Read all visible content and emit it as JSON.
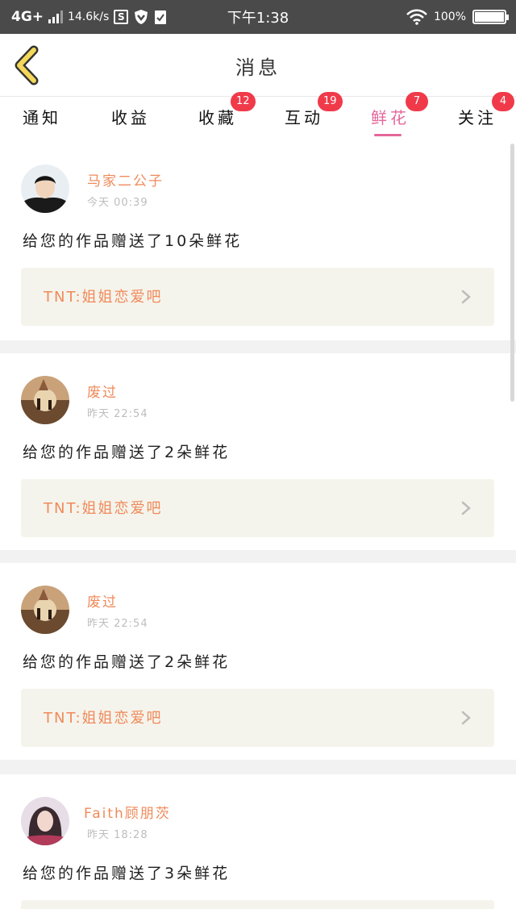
{
  "status_bar": {
    "network": "4G+",
    "speed": "14.6k/s",
    "s_icon_letter": "S",
    "time": "下午1:38",
    "battery_percent": "100%"
  },
  "header": {
    "title": "消息"
  },
  "tabs": [
    {
      "label": "通知",
      "badge": null
    },
    {
      "label": "收益",
      "badge": null
    },
    {
      "label": "收藏",
      "badge": "12"
    },
    {
      "label": "互动",
      "badge": "19"
    },
    {
      "label": "鲜花",
      "badge": "7",
      "active": true
    },
    {
      "label": "关注",
      "badge": "4"
    }
  ],
  "colors": {
    "accent_pink": "#e5679b",
    "name_orange": "#f08a5a",
    "badge_red": "#f03a4a",
    "quote_bg": "#f5f4ec"
  },
  "messages": [
    {
      "user": "马家二公子",
      "time": "今天 00:39",
      "text": "给您的作品赠送了10朵鲜花",
      "quote": "TNT:姐姐恋爱吧",
      "avatar": "boy-photo"
    },
    {
      "user": "废过",
      "time": "昨天 22:54",
      "text": "给您的作品赠送了2朵鲜花",
      "quote": "TNT:姐姐恋爱吧",
      "avatar": "sunset-silhouette"
    },
    {
      "user": "废过",
      "time": "昨天 22:54",
      "text": "给您的作品赠送了2朵鲜花",
      "quote": "TNT:姐姐恋爱吧",
      "avatar": "sunset-silhouette"
    },
    {
      "user": "Faith顾朋茨",
      "time": "昨天 18:28",
      "text": "给您的作品赠送了3朵鲜花",
      "quote": "",
      "avatar": "girl-photo"
    }
  ]
}
